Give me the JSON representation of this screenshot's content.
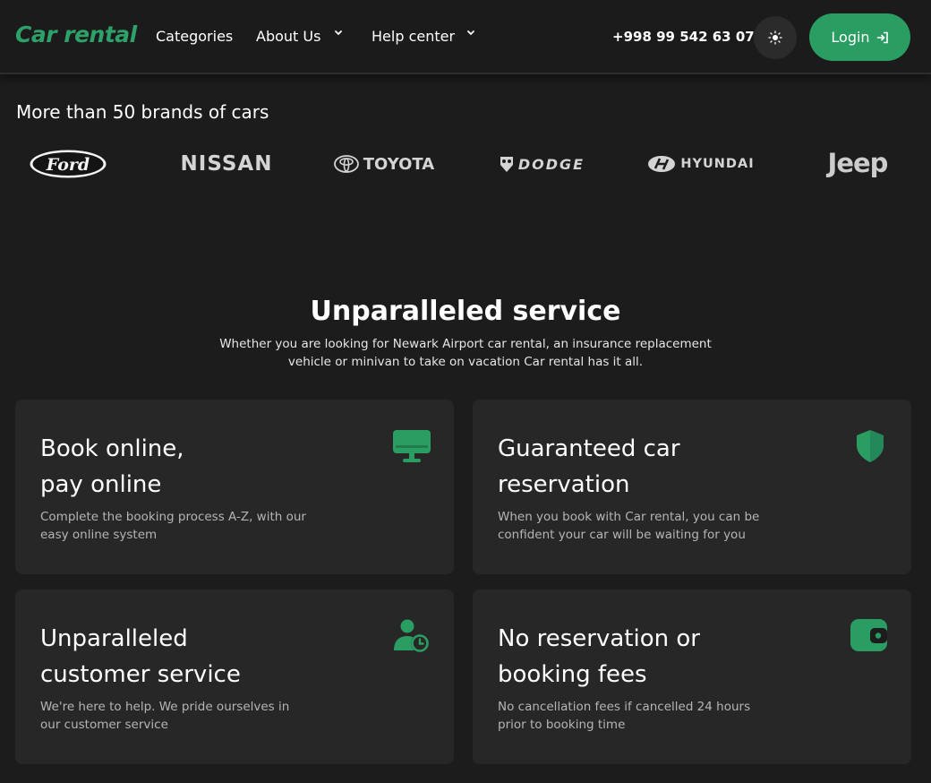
{
  "header": {
    "logo": "Car rental",
    "nav": [
      {
        "label": "Categories"
      },
      {
        "label": "About Us"
      },
      {
        "label": "Help center"
      }
    ],
    "phone": "+998 99 542 63 07",
    "theme_icon": "sun-icon",
    "login_label": "Login",
    "login_icon": "login-arrow-icon"
  },
  "brands": {
    "title": "More than 50 brands of cars",
    "items": [
      "Ford",
      "NISSAN",
      "TOYOTA",
      "DODGE",
      "HYUNDAI",
      "Jeep"
    ]
  },
  "service": {
    "title": "Unparalleled service",
    "subtitle_line1": "Whether you are looking for Newark Airport car rental, an insurance replacement",
    "subtitle_line2": "vehicle or minivan to take on vacation Car rental has it all.",
    "cards": [
      {
        "title_l1": "Book online,",
        "title_l2": "pay online",
        "desc_l1": "Complete the booking process A-Z, with our",
        "desc_l2": "easy online system",
        "icon": "monitor-icon"
      },
      {
        "title_l1": "Guaranteed car",
        "title_l2": "reservation",
        "desc_l1": "When you book with Car rental, you can be",
        "desc_l2": "confident your car will be waiting for you",
        "icon": "shield-icon"
      },
      {
        "title_l1": "Unparalleled",
        "title_l2": "customer service",
        "desc_l1": "We're here to help. We pride ourselves in",
        "desc_l2": "our customer service",
        "icon": "user-clock-icon"
      },
      {
        "title_l1": "No reservation or",
        "title_l2": "booking fees",
        "desc_l1": "No cancellation fees if cancelled 24 hours",
        "desc_l2": "prior to booking time",
        "icon": "wallet-icon"
      }
    ]
  },
  "colors": {
    "accent": "#2a9d63",
    "background": "#1c1c1c",
    "card": "#272727"
  }
}
